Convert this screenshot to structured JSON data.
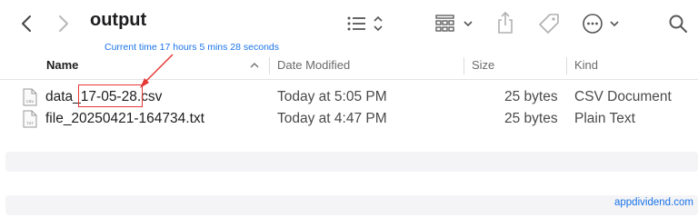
{
  "window": {
    "title": "output"
  },
  "toolbar": {
    "back_icon": "chevron-left-icon",
    "forward_icon": "chevron-right-icon",
    "list_view_icon": "list-view-icon",
    "grid_view_icon": "grid-view-icon",
    "share_icon": "share-icon",
    "tag_icon": "tag-icon",
    "more_icon": "ellipsis-circle-icon",
    "search_icon": "search-icon"
  },
  "annotation": {
    "text": "Current time 17 hours 5 mins 28 seconds",
    "color": "#1a73e8",
    "highlight_color": "#e53935"
  },
  "columns": {
    "name": "Name",
    "date_modified": "Date Modified",
    "size": "Size",
    "kind": "Kind"
  },
  "files": [
    {
      "name_prefix": "data",
      "name_highlight": "_17-05-28",
      "name_suffix": ".csv",
      "date_modified": "Today at 5:05 PM",
      "size": "25 bytes",
      "kind": "CSV Document",
      "icon_label": "CSV"
    },
    {
      "name_prefix": "file_20250421-164734.txt",
      "name_highlight": "",
      "name_suffix": "",
      "date_modified": "Today at 4:47 PM",
      "size": "25 bytes",
      "kind": "Plain Text",
      "icon_label": "TXT"
    }
  ],
  "watermark": "appdividend.com"
}
